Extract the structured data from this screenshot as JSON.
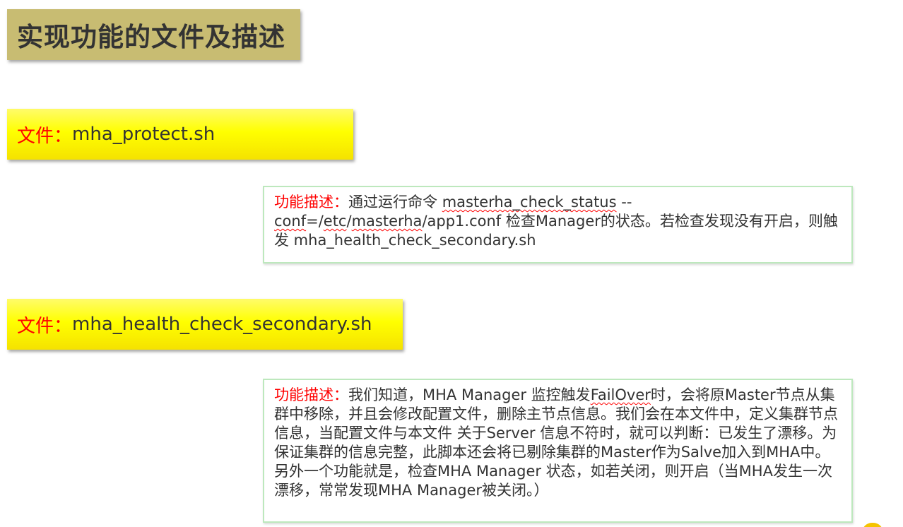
{
  "title": "实现功能的文件及描述",
  "files": [
    {
      "label": "文件：",
      "name": "mha_protect.sh",
      "desc_label": "功能描述：",
      "desc_parts": {
        "p1": "通过运行命令 ",
        "cmd": "masterha_check_status",
        "p2": " --",
        "conf_word": "conf",
        "p3": "=/",
        "etc": "etc",
        "p4": "/",
        "masterha": "masterha",
        "p5": "/app1.conf 检查Manager的状态。若检查发现没有开启，则触发 mha_health_check_secondary.sh"
      }
    },
    {
      "label": "文件：",
      "name": "mha_health_check_secondary.sh",
      "desc_label": "功能描述：",
      "desc_parts": {
        "p1": "我们知道，MHA Manager 监控触发",
        "failover": "FailOver",
        "p2": "时，会将原Master节点从集群中移除，并且会修改配置文件，删除主节点信息。我们会在本文件中，定义集群节点信息，当配置文件与本文件 关于Server 信息不符时，就可以判断：已发生了漂移。为保证集群的信息完整，此脚本还会将已剔除集群的Master作为Salve加入到MHA中。另外一个功能就是，检查MHA Manager 状态，如若关闭，则开启（当MHA发生一次漂移，常常发现MHA Manager被关闭。）"
      }
    }
  ],
  "colors": {
    "title_bg": "#c8bc72",
    "file_box_bg": "#ffff00",
    "label_red": "#ff0000",
    "desc_border": "#bde8bd"
  }
}
